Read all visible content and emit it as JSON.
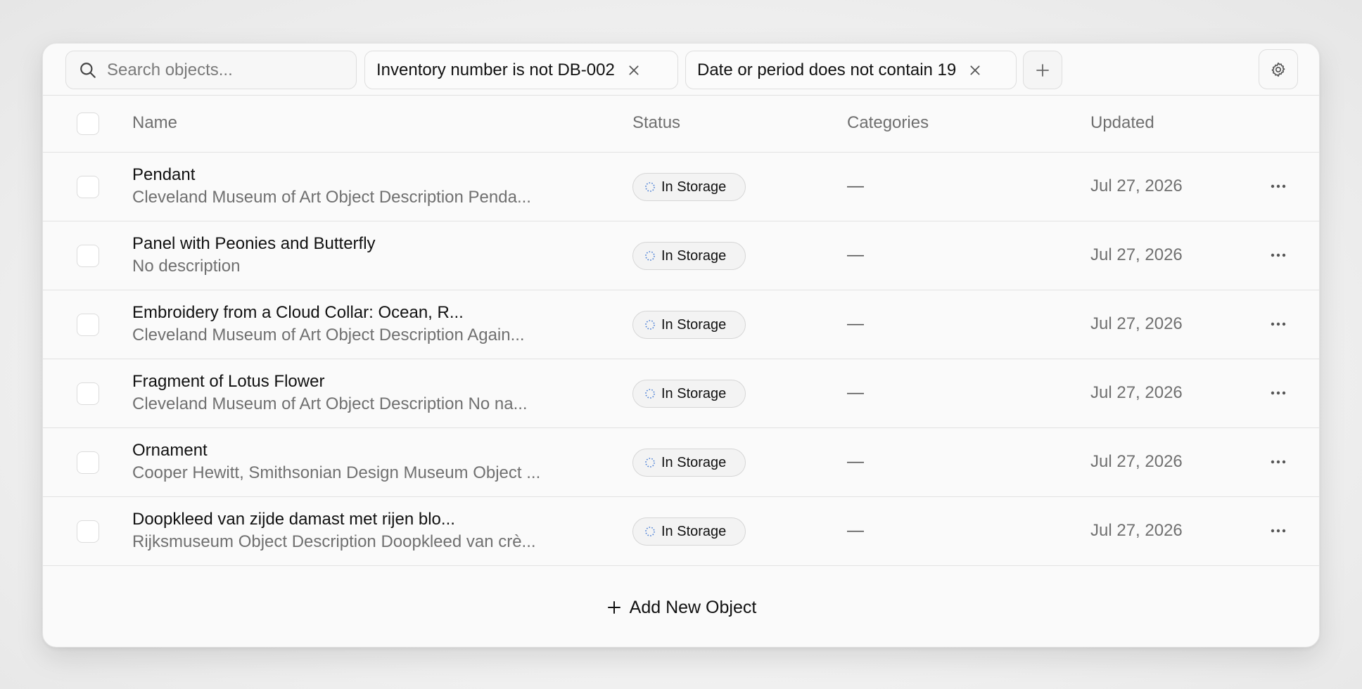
{
  "toolbar": {
    "search_placeholder": "Search objects...",
    "filters": [
      {
        "label": "Inventory number is not DB-002"
      },
      {
        "label": "Date or period does not contain 19"
      }
    ]
  },
  "table": {
    "headers": {
      "name": "Name",
      "status": "Status",
      "categories": "Categories",
      "updated": "Updated"
    },
    "rows": [
      {
        "name": "Pendant",
        "description": "Cleveland Museum of Art Object Description Penda...",
        "status": "In Storage",
        "categories": "—",
        "updated": "Jul 27, 2026"
      },
      {
        "name": "Panel with Peonies and Butterfly",
        "description": "No description",
        "status": "In Storage",
        "categories": "—",
        "updated": "Jul 27, 2026"
      },
      {
        "name": "Embroidery from a Cloud Collar: Ocean, R...",
        "description": "Cleveland Museum of Art Object Description Again...",
        "status": "In Storage",
        "categories": "—",
        "updated": "Jul 27, 2026"
      },
      {
        "name": "Fragment of Lotus Flower",
        "description": "Cleveland Museum of Art Object Description No na...",
        "status": "In Storage",
        "categories": "—",
        "updated": "Jul 27, 2026"
      },
      {
        "name": "Ornament",
        "description": "Cooper Hewitt, Smithsonian Design Museum Object ...",
        "status": "In Storage",
        "categories": "—",
        "updated": "Jul 27, 2026"
      },
      {
        "name": "Doopkleed van zijde damast met rijen blo...",
        "description": "Rijksmuseum Object Description Doopkleed van crè...",
        "status": "In Storage",
        "categories": "—",
        "updated": "Jul 27, 2026"
      }
    ]
  },
  "footer": {
    "add_label": "Add New Object"
  },
  "icons": {
    "search": "search-icon",
    "filter_remove": "close-icon",
    "add_filter": "plus-icon",
    "settings": "gear-icon",
    "status": "dotted-circle-icon",
    "row_actions": "more-horizontal-icon",
    "add_object": "plus-icon"
  },
  "colors": {
    "status_icon": "#4a7fd6"
  }
}
